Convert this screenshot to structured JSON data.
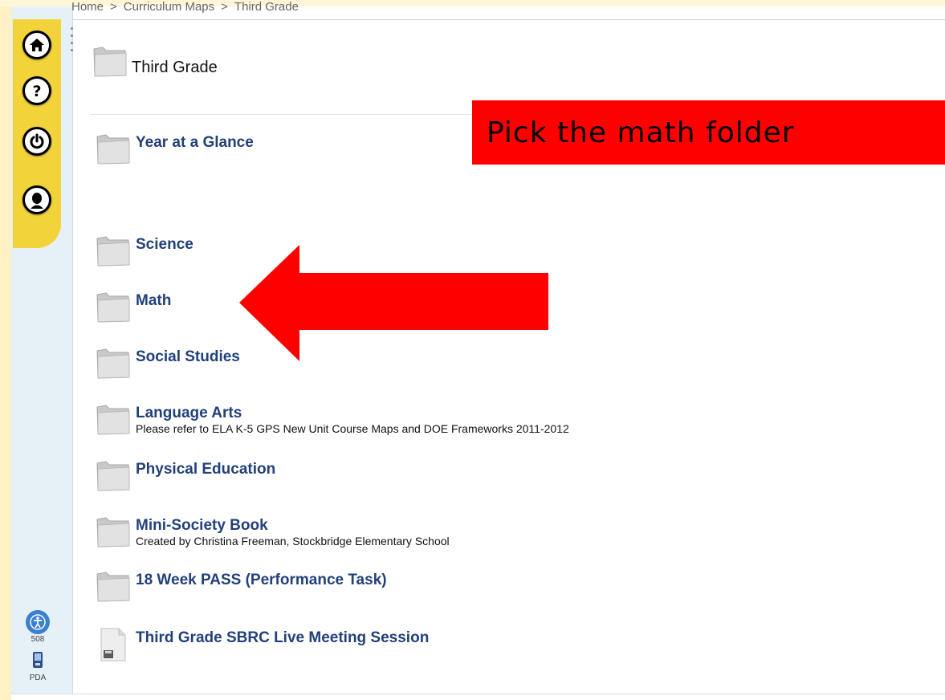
{
  "breadcrumb": {
    "items": [
      "Home",
      "Curriculum Maps",
      "Third Grade"
    ],
    "separator": ">"
  },
  "page": {
    "title": "Third Grade"
  },
  "folders": [
    {
      "label": "Year at a Glance",
      "description": "",
      "icon": "folder-icon"
    },
    {
      "label": "Science",
      "description": "",
      "icon": "folder-icon"
    },
    {
      "label": "Math",
      "description": "",
      "icon": "folder-icon"
    },
    {
      "label": "Social Studies",
      "description": "",
      "icon": "folder-icon"
    },
    {
      "label": "Language Arts",
      "description": "Please refer to ELA K-5 GPS New Unit Course Maps and DOE Frameworks 2011-2012",
      "icon": "folder-icon"
    },
    {
      "label": "Physical Education",
      "description": "",
      "icon": "folder-icon"
    },
    {
      "label": "Mini-Society Book",
      "description": "Created by Christina Freeman, Stockbridge Elementary School",
      "icon": "folder-icon"
    },
    {
      "label": "18 Week PASS (Performance Task)",
      "description": "",
      "icon": "folder-icon"
    }
  ],
  "file": {
    "label": "Third Grade SBRC Live Meeting Session",
    "icon": "file-icon"
  },
  "rail": {
    "buttons": [
      "home-icon",
      "help-icon",
      "power-icon",
      "profile-icon"
    ],
    "accessibility_label": "508",
    "pda_label": "PDA"
  },
  "callout": {
    "text": "Pick the math folder",
    "color": "#ff0000"
  },
  "colors": {
    "link": "#22407a",
    "rail_accent": "#f2d43a",
    "arrow": "#ff0000"
  }
}
